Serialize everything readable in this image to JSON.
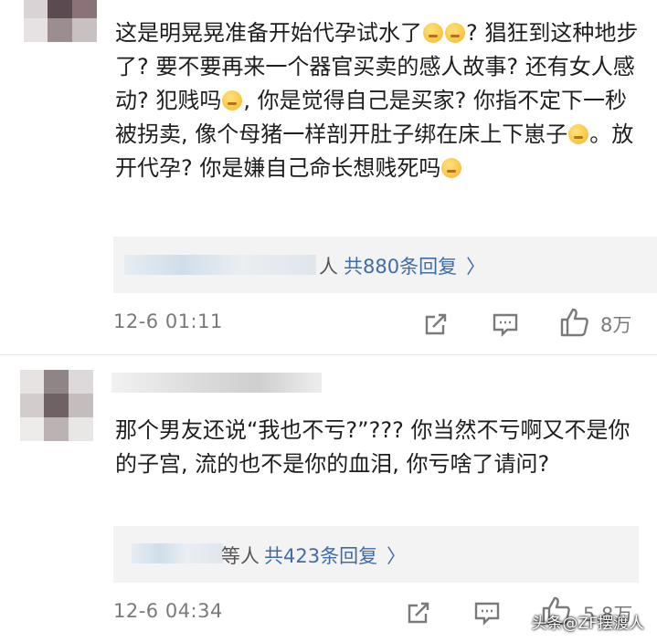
{
  "comments": [
    {
      "text_parts": [
        "这是明晃晃准备开始代孕试水了",
        "? 猖狂到这种地步了? 要不要再来一个器官买卖的感人故事? 还有女人感动? 犯贱吗",
        ", 你是觉得自己是买家? 你指不定下一秒被拐卖, 像个母猪一样剖开肚子绑在床上下崽子",
        "。放开代孕? 你是嫌自己命长想贱死吗"
      ],
      "reply_suffix": "人",
      "reply_link": "共880条回复",
      "time": "12-6 01:11",
      "likes": "8万"
    },
    {
      "text": "那个男友还说“我也不亏?”??? 你当然不亏啊又不是你的子宫, 流的也不是你的血泪, 你亏啥了请问?",
      "reply_suffix": "等人",
      "reply_link": "共423条回复",
      "time": "12-6 04:34",
      "likes": "5.8万"
    }
  ],
  "icons": {
    "chevron": "chevron-right-icon",
    "share": "share-icon",
    "comment": "comment-icon",
    "like": "thumbs-up-icon"
  },
  "watermark": "头条@ZF摆渡人",
  "colors": {
    "link": "#3f6ca8",
    "meta": "#7a7a7a",
    "reply_bg": "#f3f3f3"
  }
}
